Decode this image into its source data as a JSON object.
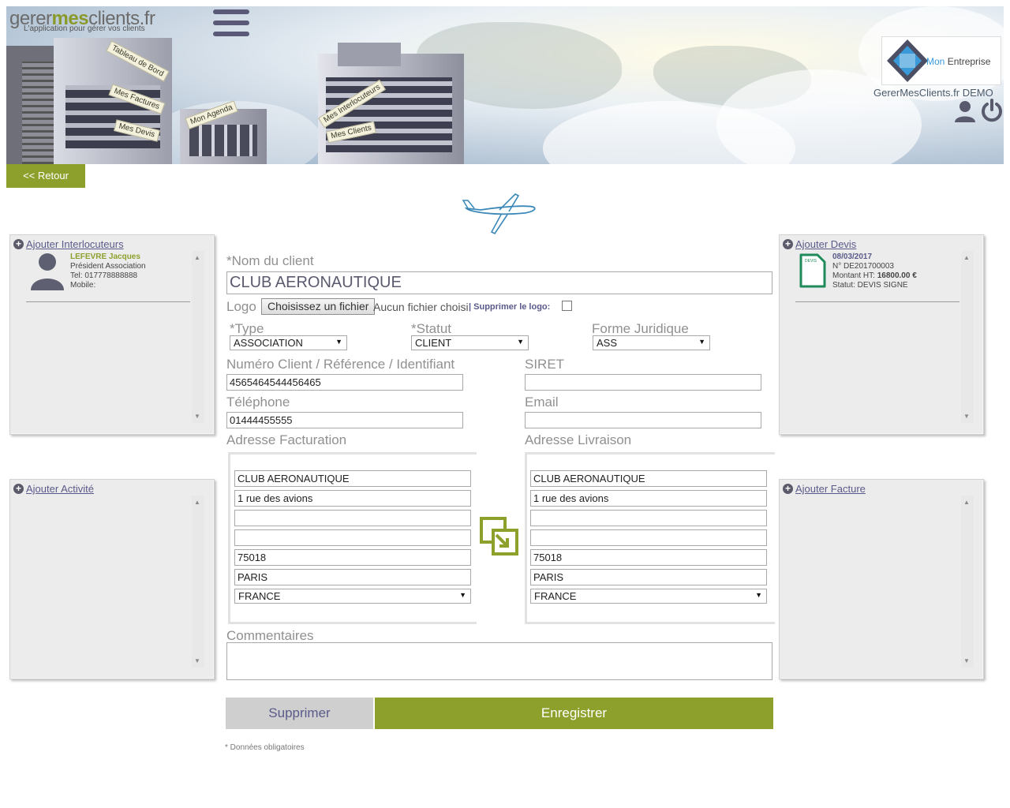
{
  "header": {
    "logo_main_1": "gerer",
    "logo_main_2": "mes",
    "logo_main_3": "clients.fr",
    "logo_sub": "L'application pour gérer vos clients",
    "signs": [
      "Tableau de Bord",
      "Mes Factures",
      "Mes Devis",
      "Mon Agenda",
      "Mes Interlocuteurs",
      "Mes Clients"
    ],
    "company_mon": "Mon",
    "company_name": "Entreprise",
    "demo_label": "GererMesClients.fr DEMO"
  },
  "nav": {
    "back_label": "<< Retour"
  },
  "panels": {
    "interlocuteurs": {
      "title": "Ajouter Interlocuteurs",
      "contact": {
        "name": "LEFEVRE Jacques",
        "role": "Président Association",
        "tel": "Tel: 017778888888",
        "mobile": "Mobile:"
      }
    },
    "devis": {
      "title": "Ajouter Devis",
      "item": {
        "date": "08/03/2017",
        "number": "N° DE201700003",
        "amount_label": "Montant HT:",
        "amount": "16800.00 €",
        "status": "Statut: DEVIS SIGNE",
        "doc_tag": "DEVIS"
      }
    },
    "activite": {
      "title": "Ajouter Activité"
    },
    "facture": {
      "title": "Ajouter Facture"
    }
  },
  "form": {
    "nom_label": "*Nom du client",
    "nom_value": "CLUB AERONAUTIQUE",
    "logo_label": "Logo",
    "file_button": "Choisissez un fichier",
    "file_none": "Aucun fichier choisi",
    "remove_logo": "| Supprimer le logo:",
    "type_label": "*Type",
    "type_value": "ASSOCIATION",
    "statut_label": "*Statut",
    "statut_value": "CLIENT",
    "forme_label": "Forme Juridique",
    "forme_value": "ASS",
    "numero_label": "Numéro Client / Référence / Identifiant",
    "numero_value": "4565464544456465",
    "siret_label": "SIRET",
    "siret_value": "",
    "telephone_label": "Téléphone",
    "telephone_value": "01444455555",
    "email_label": "Email",
    "email_value": "",
    "facturation_label": "Adresse Facturation",
    "livraison_label": "Adresse Livraison",
    "facturation": {
      "name": "CLUB AERONAUTIQUE",
      "line1": "1 rue des avions",
      "line2": "",
      "line3": "",
      "zip": "75018",
      "city": "PARIS",
      "country": "FRANCE"
    },
    "livraison": {
      "name": "CLUB AERONAUTIQUE",
      "line1": "1 rue des avions",
      "line2": "",
      "line3": "",
      "zip": "75018",
      "city": "PARIS",
      "country": "FRANCE"
    },
    "commentaires_label": "Commentaires",
    "commentaires_value": ""
  },
  "actions": {
    "delete_label": "Supprimer",
    "save_label": "Enregistrer"
  },
  "footer_note": "* Données obligatoires",
  "colors": {
    "accent_green": "#8ea02c",
    "link_purple": "#5a5a8a",
    "muted_label": "#909090"
  }
}
